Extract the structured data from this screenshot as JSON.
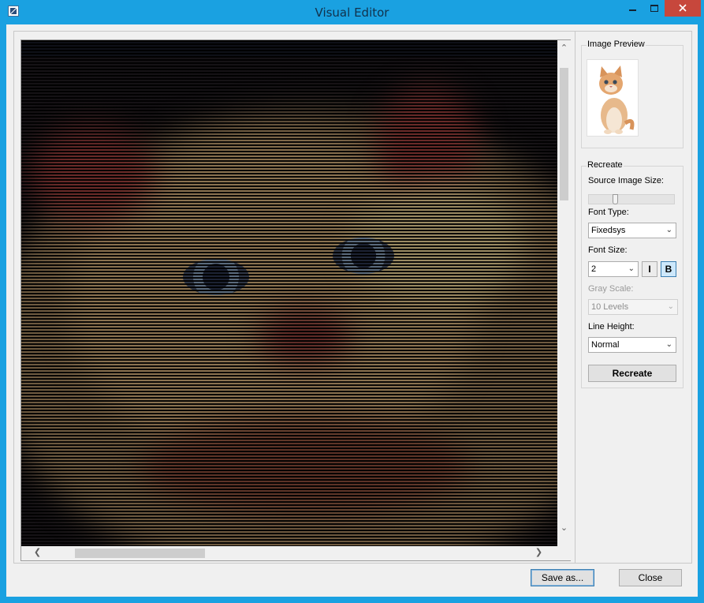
{
  "window": {
    "title": "Visual Editor"
  },
  "title_controls": {
    "minimize": "minimize-icon",
    "maximize": "maximize-icon",
    "close": "close-icon",
    "close_color": "#c7473c"
  },
  "canvas": {
    "description_icon": "ascii-art-canvas",
    "accent_color": "#1aa1e1"
  },
  "side": {
    "preview_group": "Image Preview",
    "recreate_group": "Recreate",
    "source_size_label": "Source Image Size:",
    "source_size_level": 0.3,
    "font_type_label": "Font Type:",
    "font_type_value": "Fixedsys",
    "font_size_label": "Font Size:",
    "font_size_value": "2",
    "italic_label": "I",
    "bold_label": "B",
    "gray_scale_label": "Gray Scale:",
    "gray_scale_value": "10 Levels",
    "line_height_label": "Line Height:",
    "line_height_value": "Normal",
    "recreate_button": "Recreate"
  },
  "footer": {
    "save_as": "Save as...",
    "close": "Close"
  }
}
